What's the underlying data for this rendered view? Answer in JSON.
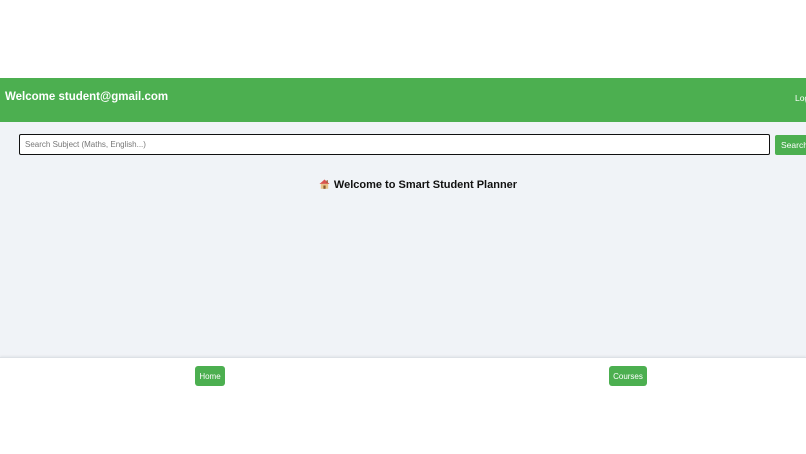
{
  "header": {
    "title": "Welcome student@gmail.com",
    "logout_label": "Logout"
  },
  "search": {
    "value": "",
    "placeholder": "Search Subject (Maths, English...)",
    "button_label": "Search"
  },
  "main": {
    "heading_icon": "house-icon",
    "heading": "Welcome to Smart Student Planner"
  },
  "footer": {
    "nav": [
      {
        "label": "Home"
      },
      {
        "label": "Courses"
      }
    ]
  },
  "colors": {
    "accent": "#4caf50",
    "content_background": "#f0f3f7",
    "page_background": "#ffffff"
  }
}
